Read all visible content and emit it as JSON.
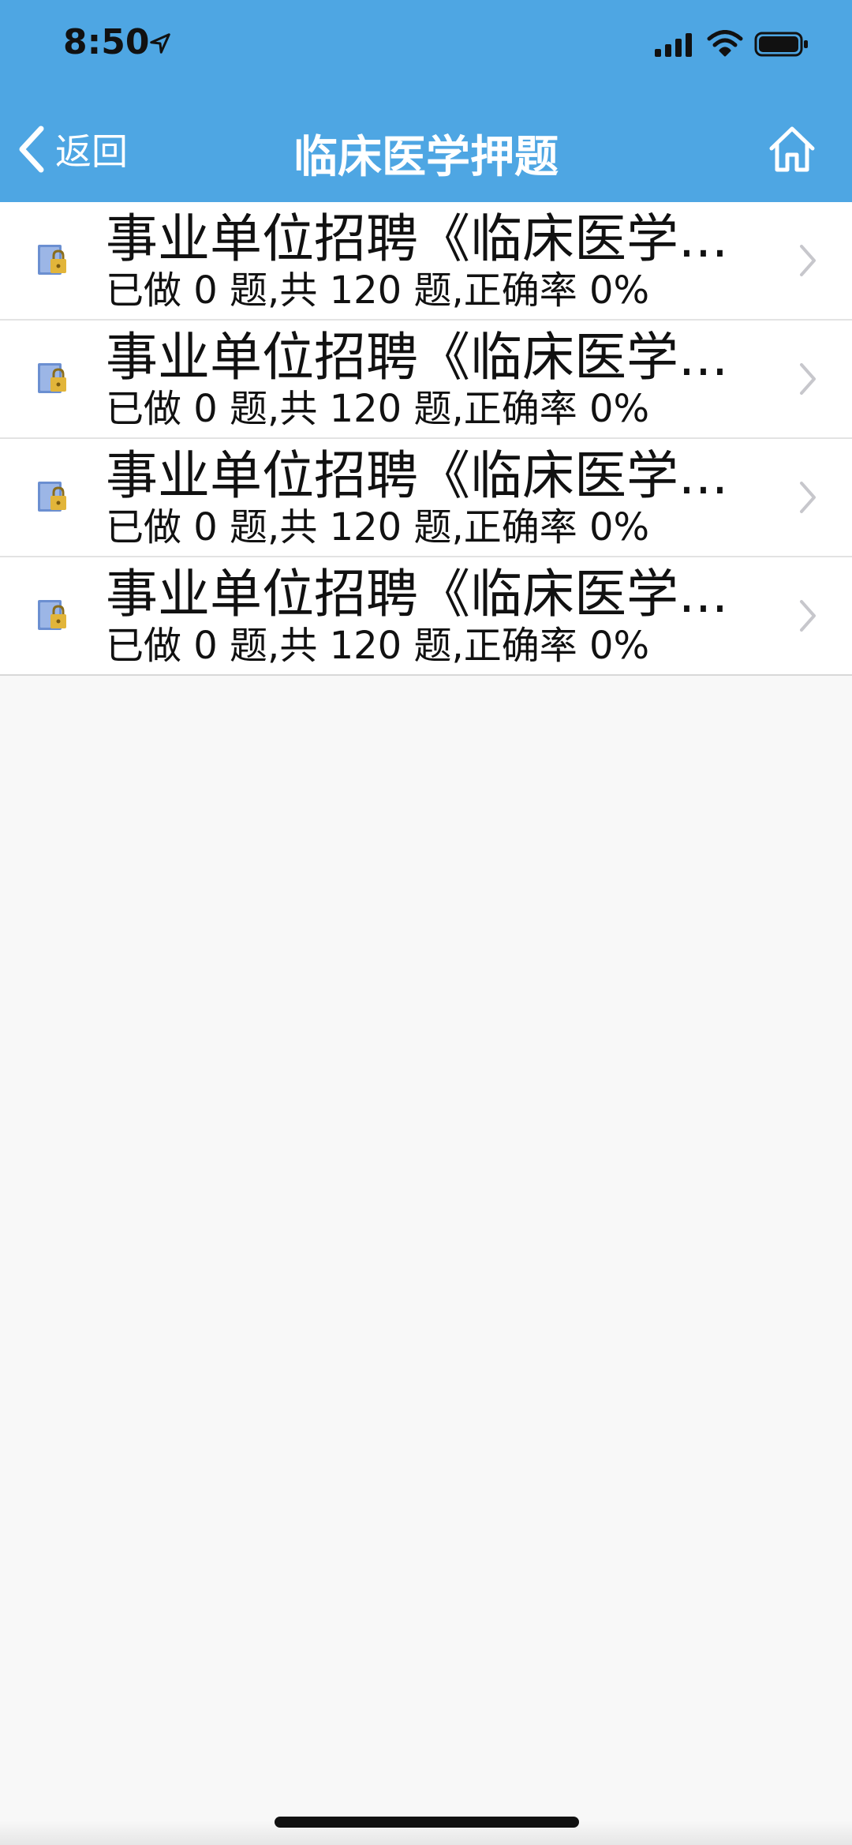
{
  "status_bar": {
    "time": "8:50",
    "icons": [
      "location-arrow-icon",
      "cellular-signal-icon",
      "wifi-icon",
      "battery-icon"
    ]
  },
  "nav": {
    "back_label": "返回",
    "title": "临床医学押题",
    "home_icon": "home-icon"
  },
  "colors": {
    "accent": "#4ea6e3",
    "background": "#f8f8f8",
    "row_background": "#ffffff",
    "chevron": "#c7c7cc"
  },
  "list": {
    "items": [
      {
        "title": "事业单位招聘《临床医学...",
        "subtitle": "已做 0 题,共 120 题,正确率 0%",
        "icon": "locked-document-icon"
      },
      {
        "title": "事业单位招聘《临床医学...",
        "subtitle": "已做 0 题,共 120 题,正确率 0%",
        "icon": "locked-document-icon"
      },
      {
        "title": "事业单位招聘《临床医学...",
        "subtitle": "已做 0 题,共 120 题,正确率 0%",
        "icon": "locked-document-icon"
      },
      {
        "title": "事业单位招聘《临床医学...",
        "subtitle": "已做 0 题,共 120 题,正确率 0%",
        "icon": "locked-document-icon"
      }
    ]
  }
}
